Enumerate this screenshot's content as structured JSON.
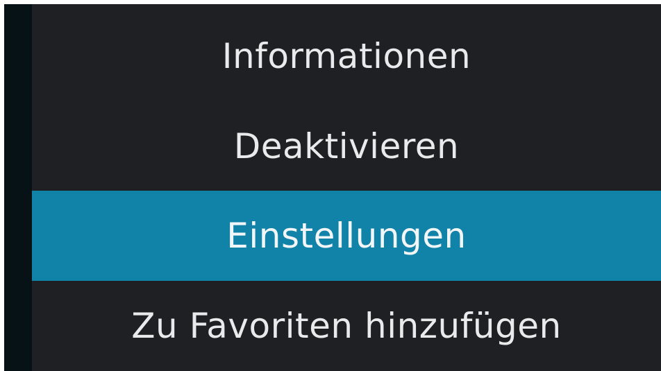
{
  "context_menu": {
    "items": [
      {
        "label": "Informationen",
        "focused": false
      },
      {
        "label": "Deaktivieren",
        "focused": false
      },
      {
        "label": "Einstellungen",
        "focused": true
      },
      {
        "label": "Zu Favoriten hinzufügen",
        "focused": false
      }
    ]
  },
  "colors": {
    "menu_background": "#1e2023",
    "focus_highlight": "#1283a8",
    "text": "#e9eaeb",
    "side_bar": "#061216"
  }
}
